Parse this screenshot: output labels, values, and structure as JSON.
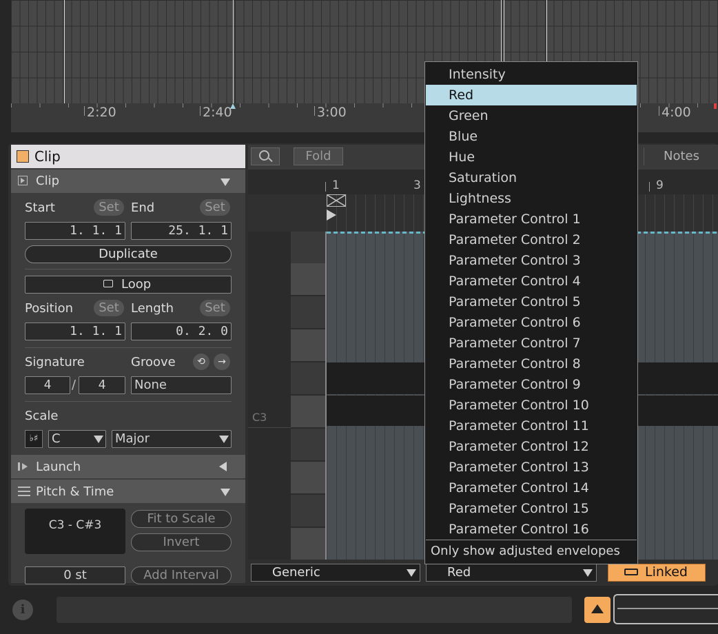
{
  "arrangement": {
    "ruler_labels": [
      "2:20",
      "2:40",
      "3:00",
      "4:00"
    ]
  },
  "clip_tab": {
    "title": "Clip"
  },
  "clip_section": {
    "title": "Clip",
    "start_label": "Start",
    "end_label": "End",
    "set_label": "Set",
    "start_value": "1.  1.  1",
    "end_value": "25.  1.  1",
    "duplicate_label": "Duplicate",
    "loop_label": "Loop",
    "position_label": "Position",
    "length_label": "Length",
    "position_value": "1.  1.  1",
    "length_value": "0.  2.  0",
    "signature_label": "Signature",
    "groove_label": "Groove",
    "sig_num": "4",
    "sig_den": "4",
    "sig_slash": "/",
    "groove_value": "None",
    "scale_label": "Scale",
    "scale_icon": "♭♯",
    "scale_root": "C",
    "scale_mode": "Major"
  },
  "launch_section": {
    "title": "Launch"
  },
  "pitch_section": {
    "title": "Pitch & Time",
    "range": "C3 - C#3",
    "fit_to_scale": "Fit to Scale",
    "invert": "Invert",
    "transpose": "0 st",
    "add_interval": "Add Interval"
  },
  "editor": {
    "fold_label": "Fold",
    "notes_tab": "Notes",
    "bar_labels": [
      "1",
      "3",
      "9"
    ],
    "key_label": "C3"
  },
  "dropdown_menu": {
    "items": [
      "Intensity",
      "Red",
      "Green",
      "Blue",
      "Hue",
      "Saturation",
      "Lightness",
      "Parameter Control 1",
      "Parameter Control 2",
      "Parameter Control 3",
      "Parameter Control 4",
      "Parameter Control 5",
      "Parameter Control 6",
      "Parameter Control 7",
      "Parameter Control 8",
      "Parameter Control 9",
      "Parameter Control 10",
      "Parameter Control 11",
      "Parameter Control 12",
      "Parameter Control 13",
      "Parameter Control 14",
      "Parameter Control 15",
      "Parameter Control 16"
    ],
    "selected": "Red",
    "footer": "Only show adjusted envelopes"
  },
  "footer": {
    "device_dropdown": "Generic",
    "control_dropdown": "Red",
    "linked_label": "Linked"
  },
  "status_bar": {
    "info_icon": "i"
  },
  "colors": {
    "accent": "#f5a95b",
    "menu_selected": "#b7dce7",
    "clip_color": "#f2b066"
  }
}
